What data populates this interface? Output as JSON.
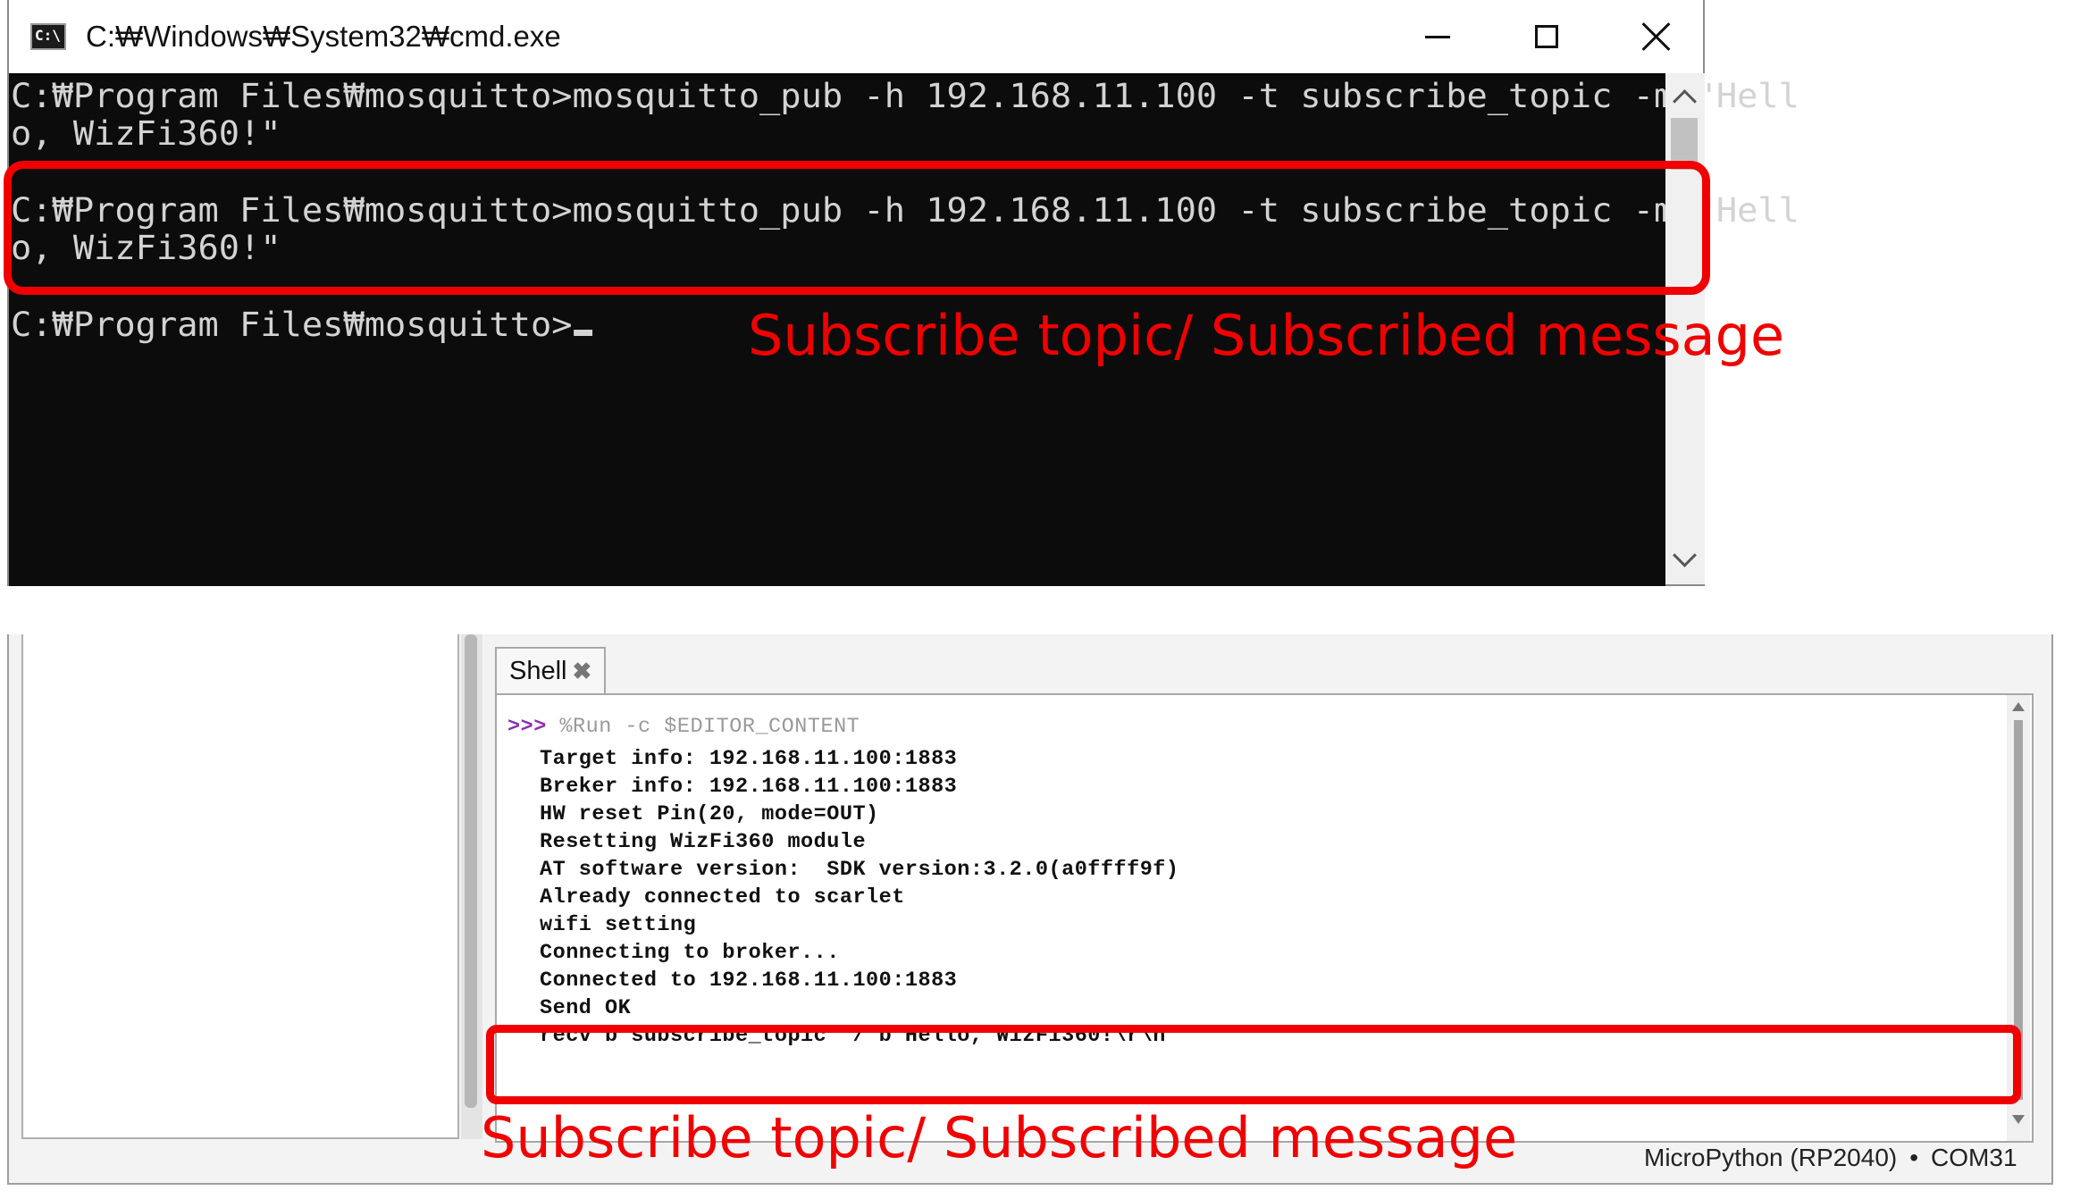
{
  "cmd": {
    "title": "C:₩Windows₩System32₩cmd.exe",
    "icon_label": "C:\\",
    "lines": [
      "C:₩Program Files₩mosquitto>mosquitto_pub -h 192.168.11.100 -t subscribe_topic -m \"Hell",
      "o, WizFi360!\"",
      "C:₩Program Files₩mosquitto>mosquitto_pub -h 192.168.11.100 -t subscribe_topic -m \"Hell",
      "o, WizFi360!\"",
      "C:₩Program Files₩mosquitto>"
    ],
    "annotation": "Subscribe topic/ Subscribed message"
  },
  "ide": {
    "tab_label": "Shell",
    "prompt_arrows": ">>>",
    "prompt_command": " %Run -c $EDITOR_CONTENT",
    "output": [
      "Target info: 192.168.11.100:1883",
      "Breker info: 192.168.11.100:1883",
      "HW reset Pin(20, mode=OUT)",
      "Resetting WizFi360 module",
      "AT software version:  SDK version:3.2.0(a0ffff9f)",
      "Already connected to scarlet",
      "wifi setting",
      "Connecting to broker...",
      "Connected to 192.168.11.100:1883",
      "Send OK",
      "recv b'subscribe_topic' / b'Hello, WizFi360!\\r\\n'"
    ],
    "annotation": "Subscribe topic/ Subscribed message",
    "status": {
      "interpreter": "MicroPython (RP2040)",
      "separator": "•",
      "port": "COM31"
    }
  },
  "colors": {
    "annotation_red": "#f00000",
    "console_bg": "#0c0c0c",
    "console_text": "#d3d3d3",
    "prompt_purple": "#8a2fb0"
  },
  "icons": [
    "cmd-app-icon",
    "minimize-icon",
    "maximize-icon",
    "close-icon",
    "scroll-up-icon",
    "scroll-down-icon",
    "tab-close-icon"
  ]
}
